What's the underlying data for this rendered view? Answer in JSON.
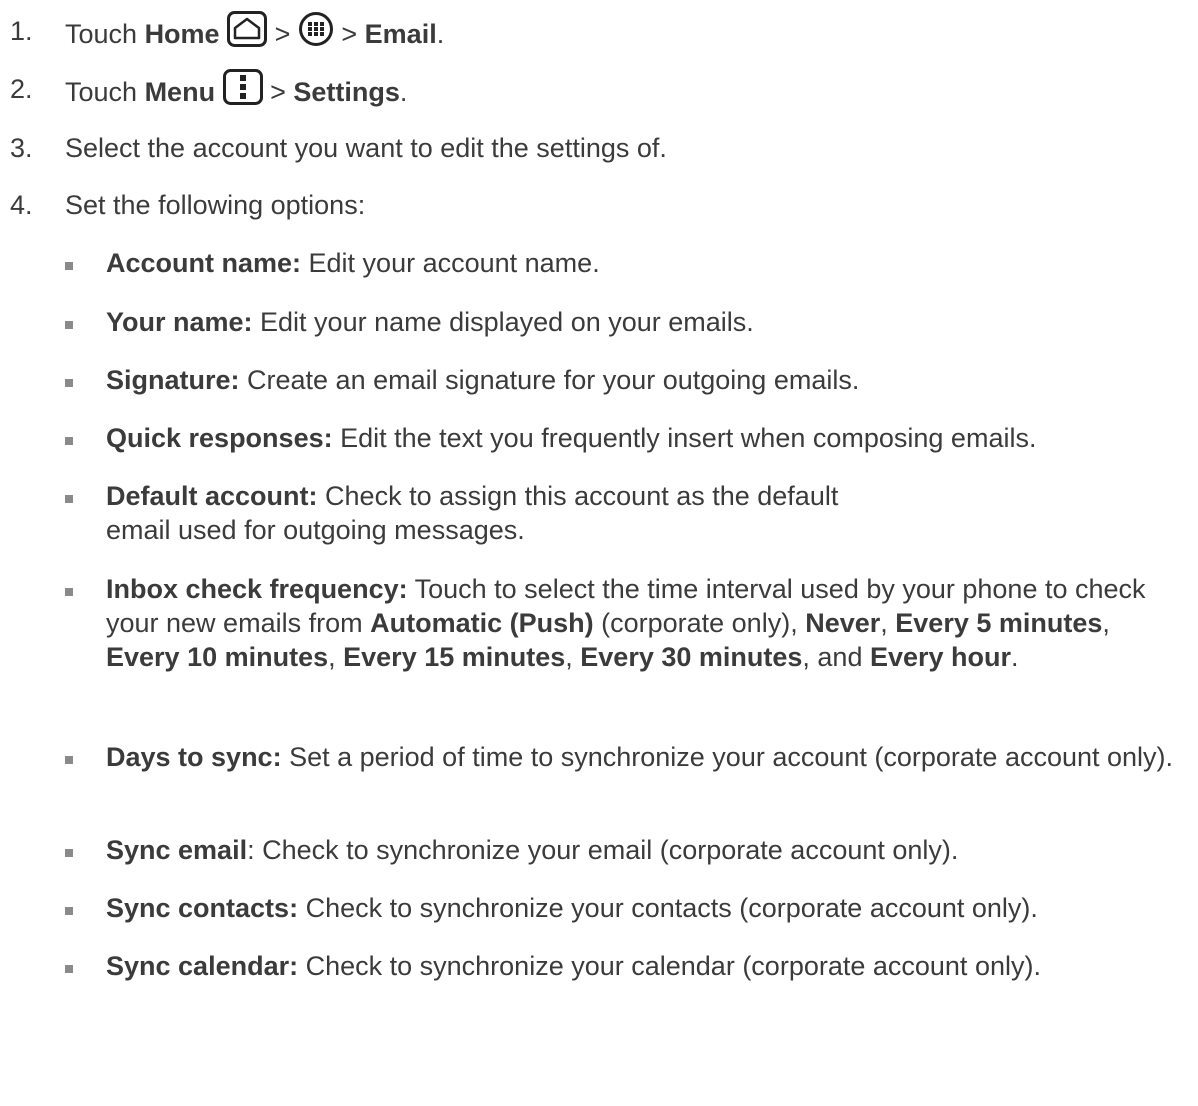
{
  "steps": [
    {
      "num": "1.",
      "a": "Touch ",
      "b1": "Home",
      "sep1": " > ",
      "sep2": " > ",
      "b2": "Email",
      "end": ".",
      "icon1": "home-icon",
      "icon2": "apps-icon"
    },
    {
      "num": "2.",
      "a": "Touch ",
      "b1": "Menu",
      "sep1": " > ",
      "b2": "Settings",
      "end": ".",
      "icon1": "menu-icon"
    },
    {
      "num": "3.",
      "text": "Select the account you want to edit the settings of."
    },
    {
      "num": "4.",
      "text": "Set the following options:"
    }
  ],
  "options": [
    {
      "label": "Account name:",
      "desc": " Edit your account name."
    },
    {
      "label": "Your name:",
      "desc": " Edit your name displayed on your emails."
    },
    {
      "label": "Signature:",
      "desc": " Create an email signature for your outgoing emails."
    },
    {
      "label": "Quick responses:",
      "desc": " Edit the text you frequently insert when composing emails."
    },
    {
      "label": "Default account:",
      "desc": " Check to assign this account as the default email used for outgoing messages."
    },
    {
      "label": "Inbox check frequency:",
      "desc": " Touch to select the time interval used by your phone to check your new emails from ",
      "o1": "Automatic (Push)",
      "t1": " (corporate only), ",
      "o2": "Never",
      "t2": ", ",
      "o3": "Every 5 minutes",
      "t3": ", ",
      "o4": "Every 10 minutes",
      "t4": ", ",
      "o5": "Every 15 minutes",
      "t5": ", ",
      "o6": "Every 30 minutes",
      "t6": ", and ",
      "o7": "Every hour",
      "t7": "."
    },
    {
      "label": "Days to sync:",
      "desc": " Set a period of time to synchronize your account (corporate account only)."
    },
    {
      "label": "Sync email",
      "desc": ": Check to synchronize your email (corporate account only)."
    },
    {
      "label": "Sync contacts:",
      "desc": " Check to synchronize your contacts (corporate account only)."
    },
    {
      "label": "Sync calendar:",
      "desc": " Check to synchronize your calendar (corporate account only)."
    }
  ]
}
